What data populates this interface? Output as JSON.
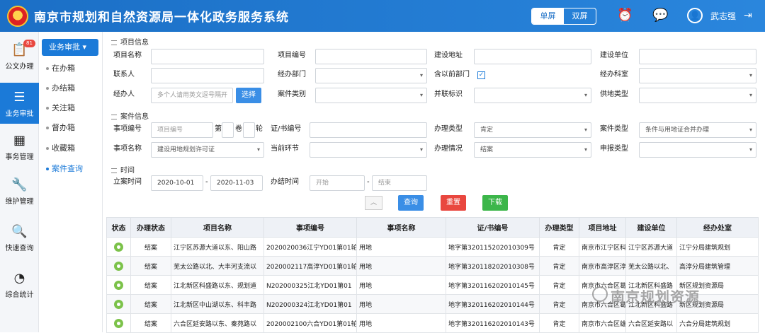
{
  "header": {
    "title": "南京市规划和自然资源局一体化政务服务系统",
    "screen_single": "单屏",
    "screen_double": "双屏",
    "user": "武志强"
  },
  "leftnav": {
    "badge": "81",
    "items": [
      {
        "label": "公文办理",
        "icon": "document-bag-icon",
        "glyph": "📋"
      },
      {
        "label": "业务审批",
        "icon": "approval-stack-icon",
        "glyph": "☰"
      },
      {
        "label": "事务管理",
        "icon": "calendar-check-icon",
        "glyph": "▦"
      },
      {
        "label": "维护管理",
        "icon": "wrench-icon",
        "glyph": "🔧"
      },
      {
        "label": "快速查询",
        "icon": "folder-search-icon",
        "glyph": "🔍"
      },
      {
        "label": "综合统计",
        "icon": "pie-chart-icon",
        "glyph": "◔"
      }
    ]
  },
  "subnav": {
    "header": "业务审批 ▾",
    "items": [
      "在办箱",
      "办结箱",
      "关注箱",
      "督办箱",
      "收藏箱",
      "案件查询"
    ]
  },
  "sections": {
    "project": "项目信息",
    "case": "案件信息",
    "time": "时间"
  },
  "project": {
    "name_label": "项目名称",
    "code_label": "项目编号",
    "address_label": "建设地址",
    "unit_label": "建设单位",
    "contact_label": "联系人",
    "dept_label": "经办部门",
    "prev_dept_label": "含以前部门",
    "section_label": "经办科室",
    "handler_label": "经办人",
    "handler_placeholder": "多个人请用英文逗号隔开",
    "select_btn": "选择",
    "case_type_label": "案件类别",
    "merge_label": "并联标识",
    "land_type_label": "供地类型"
  },
  "case": {
    "item_no_label": "事项编号",
    "item_no_placeholder": "项目编号",
    "di": "第",
    "juan": "卷",
    "lun": "轮",
    "cert_label": "证/书编号",
    "proc_type_label": "办理类型",
    "proc_type_value": "肯定",
    "case_cat_label": "案件类型",
    "case_cat_value": "条件与用地证合并办理",
    "item_name_label": "事项名称",
    "item_name_value": "建设用地规划许可证",
    "step_label": "当前环节",
    "status_label": "办理情况",
    "status_value": "结案",
    "apply_type_label": "申报类型"
  },
  "time": {
    "setup_label": "立案时间",
    "start": "2020-10-01",
    "dash": "-",
    "end": "2020-11-03",
    "finish_label": "办结时间",
    "finish_start": "开始",
    "finish_end": "结束"
  },
  "buttons": {
    "collapse": "︿",
    "query": "查询",
    "reset": "重置",
    "download": "下载",
    "query_color": "#3a8ee6",
    "reset_color": "#e9473f",
    "download_color": "#3cb64a"
  },
  "table": {
    "headers": [
      "状态",
      "办理状态",
      "项目名称",
      "事项编号",
      "事项名称",
      "证/书编号",
      "办理类型",
      "项目地址",
      "建设单位",
      "经办处室"
    ],
    "rows": [
      [
        "结案",
        "江宁区苏源大道以东、阳山路",
        "2020020036江宁YD01第01轮",
        "用地",
        "地字第320115202010309号",
        "肯定",
        "南京市江宁区科",
        "江宁区苏源大道",
        "江宁分局建筑规划"
      ],
      [
        "结案",
        "芜太公路以北、大丰河支流以",
        "2020002117高淳YD01第01轮",
        "用地",
        "地字第320118202010308号",
        "肯定",
        "南京市高淳区淳",
        "芜太公路以北、",
        "高淳分局建筑管理"
      ],
      [
        "结案",
        "江北新区科盛路以东、规划道",
        "N202000325江北YD01第01",
        "用地",
        "地字第320116202010145号",
        "肯定",
        "南京市六合区葛",
        "江北新区科盛路",
        "新区规划资源局"
      ],
      [
        "结案",
        "江北新区中山湖以东、科丰路",
        "N202000324江北YD01第01",
        "用地",
        "地字第320116202010144号",
        "肯定",
        "南京市六合区葛",
        "江北新区科盛路",
        "新区规划资源局"
      ],
      [
        "结案",
        "六合区延安路以东、秦苑路以",
        "2020002100六合YD01第01轮",
        "用地",
        "地字第320116202010143号",
        "肯定",
        "南京市六合区雄",
        "六合区延安路以",
        "六合分局建筑规划"
      ]
    ]
  },
  "watermark": "南京规划资源"
}
